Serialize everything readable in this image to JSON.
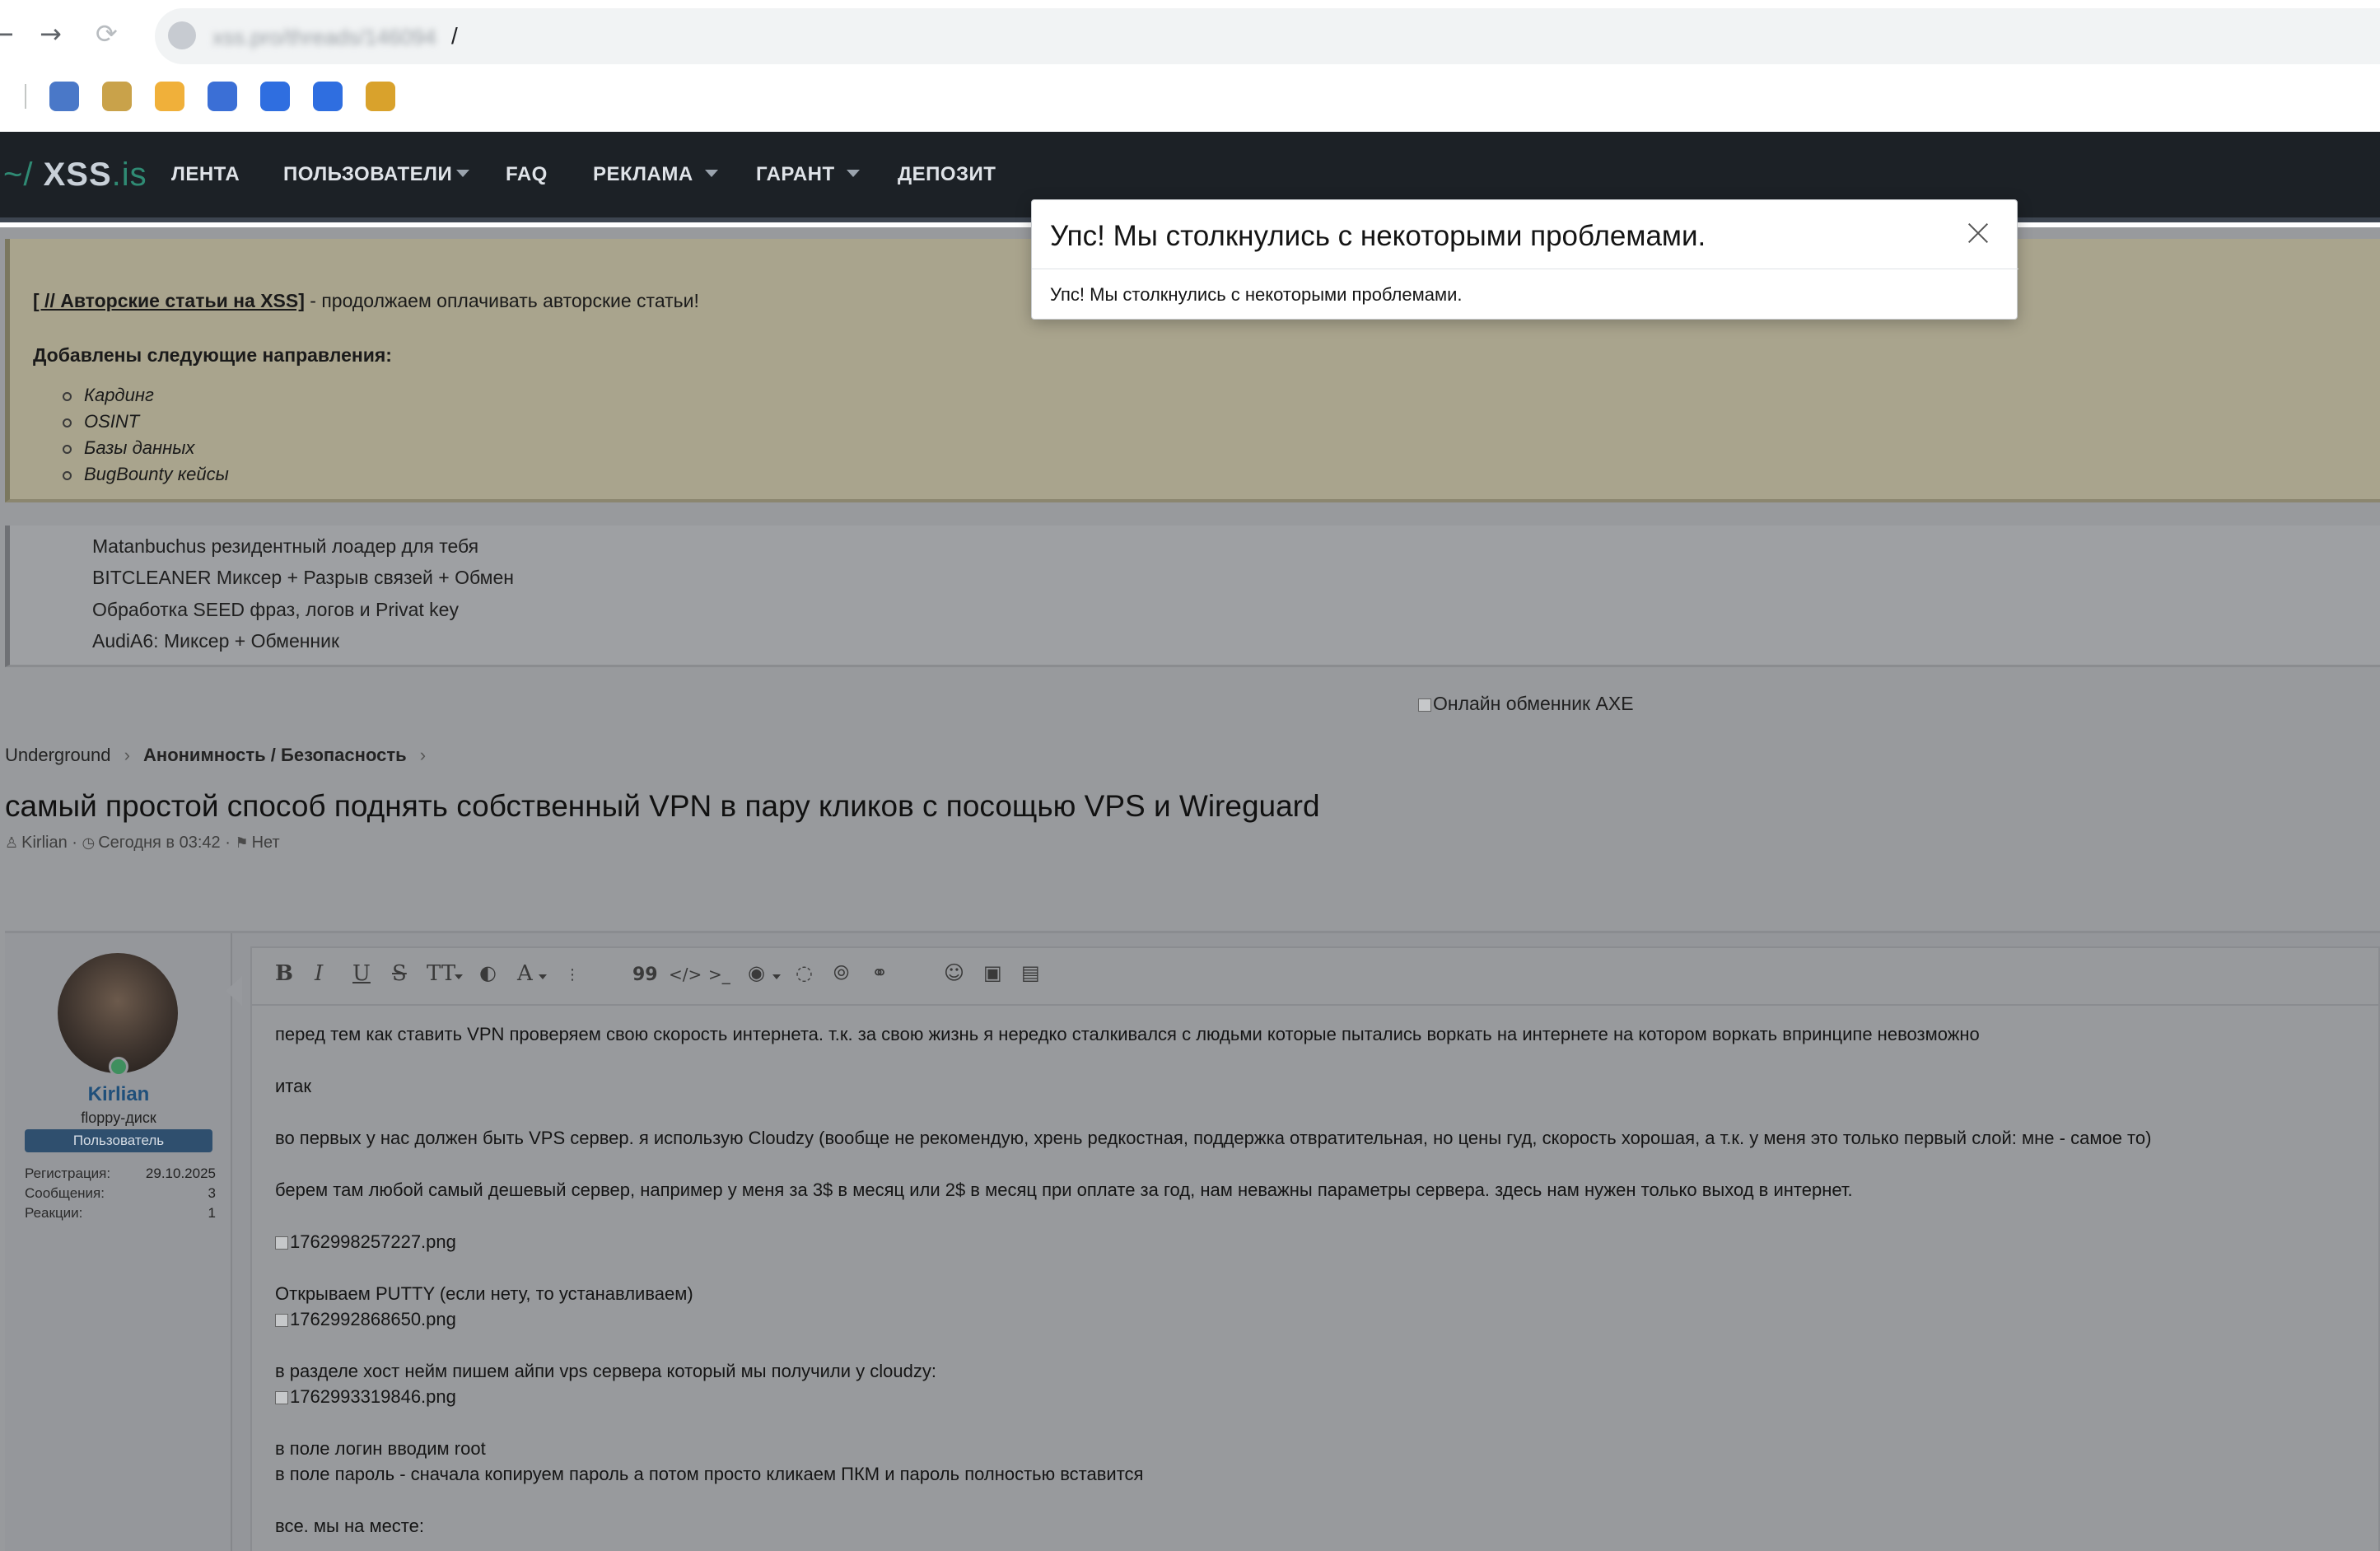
{
  "browser": {
    "back_icon": "←",
    "forward_icon": "→",
    "reload_icon": "⟳",
    "url_text": "xss.pro/threads/146094",
    "url_suffix": "/",
    "bookmark_colors": [
      "#4a78c8",
      "#c9a24a",
      "#f0b03a",
      "#3b6fd6",
      "#2f6ee0",
      "#2f6ee0",
      "#d9a22c"
    ]
  },
  "site": {
    "logo_prefix": "~/",
    "logo_main": "XSS",
    "logo_tld": ".is",
    "nav": [
      "ЛЕНТА",
      "ПОЛЬЗОВАТЕЛИ",
      "FAQ",
      "РЕКЛАМА",
      "ГАРАНТ",
      "ДЕПОЗИТ"
    ]
  },
  "notice": {
    "link": "[ // Авторские статьи на XSS]",
    "text": " - продолжаем оплачивать авторские статьи!",
    "heading": "Добавлены следующие направления:",
    "items": [
      "Кардинг",
      "OSINT",
      "Базы данных",
      "BugBounty кейсы"
    ]
  },
  "ads": [
    "Matanbuchus резидентный лоадер для тебя",
    "BITCLEANER Миксер + Разрыв связей + Обмен",
    "Обработка SEED фраз, логов и Privat key",
    "AudiA6: Миксер + Обменник"
  ],
  "exchanger_alt": "Онлайн обменник AXE",
  "breadcrumb": {
    "items": [
      "Underground",
      "Анонимность / Безопасность"
    ],
    "separator": "›"
  },
  "thread": {
    "title": "самый простой способ поднять собственный VPN в пару кликов с посощью VPS и Wireguard",
    "author": "Kirlian",
    "date": "Сегодня в 03:42",
    "tags": "Нет"
  },
  "user": {
    "name": "Kirlian",
    "title": "floppy-диск",
    "role": "Пользователь",
    "stats": [
      {
        "label": "Регистрация:",
        "value": "29.10.2025"
      },
      {
        "label": "Сообщения:",
        "value": "3"
      },
      {
        "label": "Реакции:",
        "value": "1"
      }
    ]
  },
  "editor": {
    "toolbar": {
      "bold": "B",
      "italic": "I",
      "underline": "U",
      "strike": "S",
      "textsize": "TT",
      "color": "◐",
      "font": "A",
      "more": "⋮",
      "quote": "99",
      "code": "</>",
      "inline_code": ">_",
      "fingerprint": "◉",
      "hide": "◌",
      "spoiler": "⦾",
      "link": "⚭",
      "emoji": "☺",
      "image": "▣",
      "gallery": "▤"
    },
    "paragraphs": [
      "перед тем как ставить VPN  проверяем свою скорость интернета. т.к. за свою жизнь я нередко сталкивался с людьми которые пытались воркать на интернете на котором воркать впринципе невозможно",
      "итак",
      "во первых у нас должен быть VPS сервер. я использую Cloudzy (вообще не рекомендую, хрень редкостная, поддержка отвратительная, но цены гуд, скорость хорошая, а т.к. у меня это только первый слой: мне - самое то)",
      "берем там любой самый дешевый сервер, например у меня за 3$ в месяц или 2$ в месяц при оплате за год, нам неважны параметры сервера.  здесь нам нужен только выход в интернет.",
      "1762998257227.png",
      "Открываем PUTTY (если нету, то устанавливаем)",
      "1762992868650.png",
      "в разделе хост нейм пишем айпи vps сервера который мы получили у cloudzy:",
      "1762993319846.png",
      "в поле логин вводим root",
      "в поле пароль -  сначала копируем пароль а потом просто кликаем ПКМ и пароль полностью вставится",
      "все. мы на месте:"
    ]
  },
  "modal": {
    "title": "Упс! Мы столкнулись с некоторыми проблемами.",
    "body": "Упс! Мы столкнулись с некоторыми проблемами."
  }
}
